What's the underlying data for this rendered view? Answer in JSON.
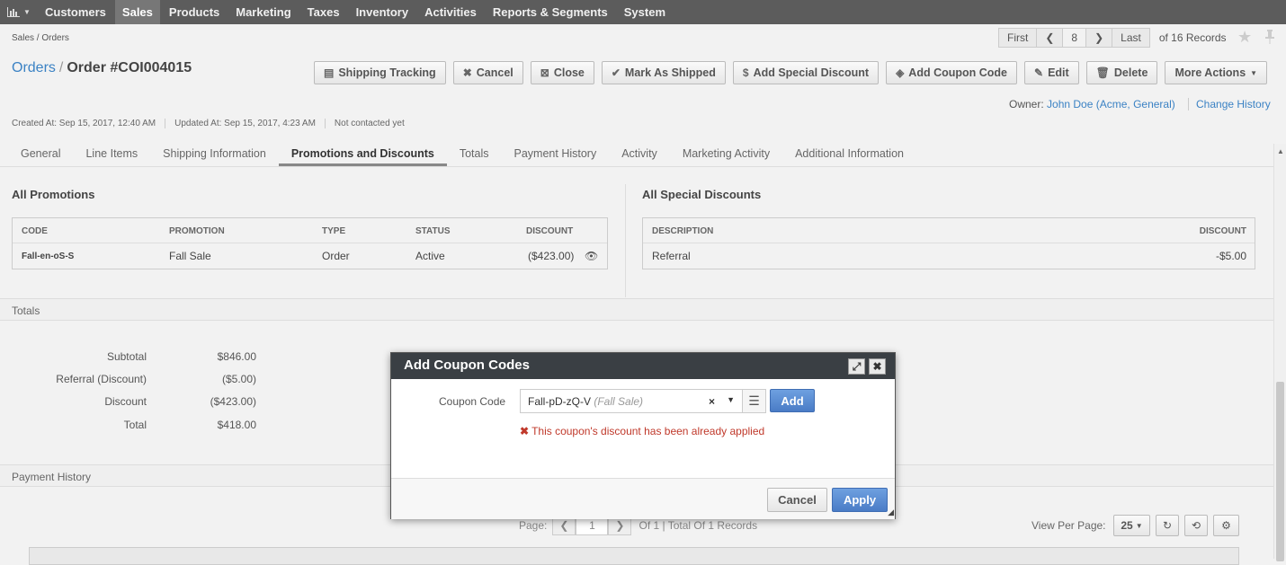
{
  "topnav": {
    "dashboard_icon": "bar-chart-icon",
    "items": [
      "Customers",
      "Sales",
      "Products",
      "Marketing",
      "Taxes",
      "Inventory",
      "Activities",
      "Reports & Segments",
      "System"
    ],
    "active": "Sales"
  },
  "breadcrumb": "Sales / Orders",
  "pager": {
    "first": "First",
    "current": "8",
    "last": "Last",
    "of_records": "of 16 Records"
  },
  "title": {
    "section": "Orders",
    "separator": "/",
    "order": "Order #COI004015"
  },
  "actions": [
    {
      "label": "Shipping Tracking",
      "icon": "list-icon"
    },
    {
      "label": "Cancel",
      "icon": "close-icon"
    },
    {
      "label": "Close",
      "icon": "close-box-icon"
    },
    {
      "label": "Mark As Shipped",
      "icon": "check-icon"
    },
    {
      "label": "Add Special Discount",
      "icon": "dollar-icon"
    },
    {
      "label": "Add Coupon Code",
      "icon": "tag-icon"
    },
    {
      "label": "Edit",
      "icon": "edit-icon"
    },
    {
      "label": "Delete",
      "icon": "trash-icon"
    },
    {
      "label": "More Actions",
      "icon": "caret-down-icon"
    }
  ],
  "owner": {
    "label": "Owner:",
    "value": "John Doe (Acme, General)",
    "change_history": "Change History"
  },
  "meta": {
    "created": "Created At: Sep 15, 2017, 12:40 AM",
    "updated": "Updated At: Sep 15, 2017, 4:23 AM",
    "contacted": "Not contacted yet"
  },
  "tabs": [
    "General",
    "Line Items",
    "Shipping Information",
    "Promotions and Discounts",
    "Totals",
    "Payment History",
    "Activity",
    "Marketing Activity",
    "Additional Information"
  ],
  "active_tab": "Promotions and Discounts",
  "promotions": {
    "title": "All Promotions",
    "headers": [
      "CODE",
      "PROMOTION",
      "TYPE",
      "STATUS",
      "DISCOUNT"
    ],
    "rows": [
      [
        "Fall-en-oS-S",
        "Fall Sale",
        "Order",
        "Active",
        "($423.00)"
      ]
    ]
  },
  "special_discounts": {
    "title": "All Special Discounts",
    "headers": [
      "DESCRIPTION",
      "DISCOUNT"
    ],
    "rows": [
      [
        "Referral",
        "-$5.00"
      ]
    ]
  },
  "totals": {
    "title": "Totals",
    "rows": [
      {
        "label": "Subtotal",
        "value": "$846.00"
      },
      {
        "label": "Referral (Discount)",
        "value": "($5.00)"
      },
      {
        "label": "Discount",
        "value": "($423.00)"
      },
      {
        "label": "Total",
        "value": "$418.00"
      }
    ]
  },
  "payment_history": {
    "title": "Payment History",
    "page_label": "Page:",
    "page_value": "1",
    "page_summary": "Of 1 | Total Of 1 Records",
    "view_per_page_label": "View Per Page:",
    "view_per_page_value": "25"
  },
  "dialog": {
    "title": "Add Coupon Codes",
    "coupon_label": "Coupon Code",
    "coupon_value": "Fall-pD-zQ-V",
    "coupon_hint": "(Fall Sale)",
    "add": "Add",
    "error": "This coupon's discount has been already applied",
    "cancel": "Cancel",
    "apply": "Apply"
  }
}
